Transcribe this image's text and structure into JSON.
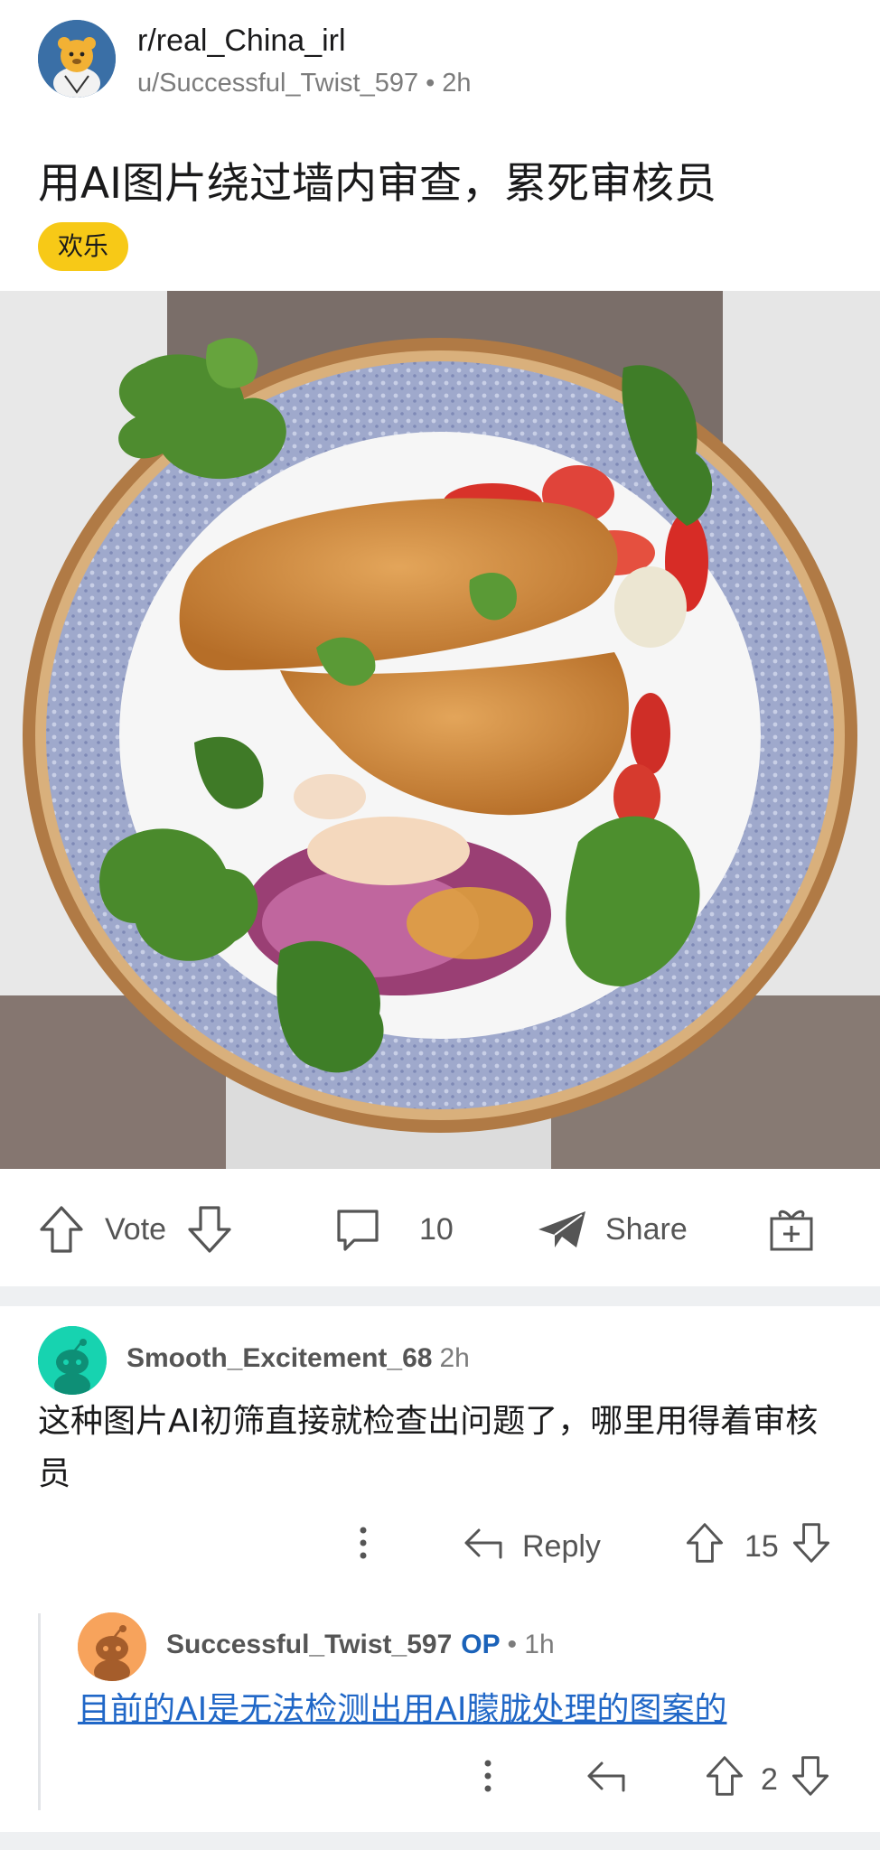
{
  "post": {
    "subreddit": "r/real_China_irl",
    "author": "u/Successful_Twist_597",
    "separator": "•",
    "time": "2h",
    "title": "用AI图片绕过墙内审查，累死审核员",
    "flair": "欢乐",
    "flair_color": "#f7c917",
    "image_alt": "fried chicken cutlet on decorative blue plate with salad and tomatoes"
  },
  "actions": {
    "vote_label": "Vote",
    "comment_count": "10",
    "share_label": "Share",
    "upvote_icon": "arrow-up-outline-icon",
    "downvote_icon": "arrow-down-outline-icon",
    "comment_icon": "speech-bubble-icon",
    "share_icon": "paper-plane-icon",
    "award_icon": "gift-box-icon"
  },
  "comments": [
    {
      "username": "Smooth_Excitement_68",
      "time": "2h",
      "body": "这种图片AI初筛直接就检查出问题了，哪里用得着审核员",
      "reply_label": "Reply",
      "score": "15",
      "avatar_color": "#17d3b0",
      "replies": [
        {
          "username": "Successful_Twist_597",
          "op_badge": "OP",
          "time": "• 1h",
          "body": "目前的AI是无法检测出用AI朦胧处理的图案的",
          "score": "2",
          "avatar_color": "#f7a35c"
        }
      ]
    }
  ]
}
